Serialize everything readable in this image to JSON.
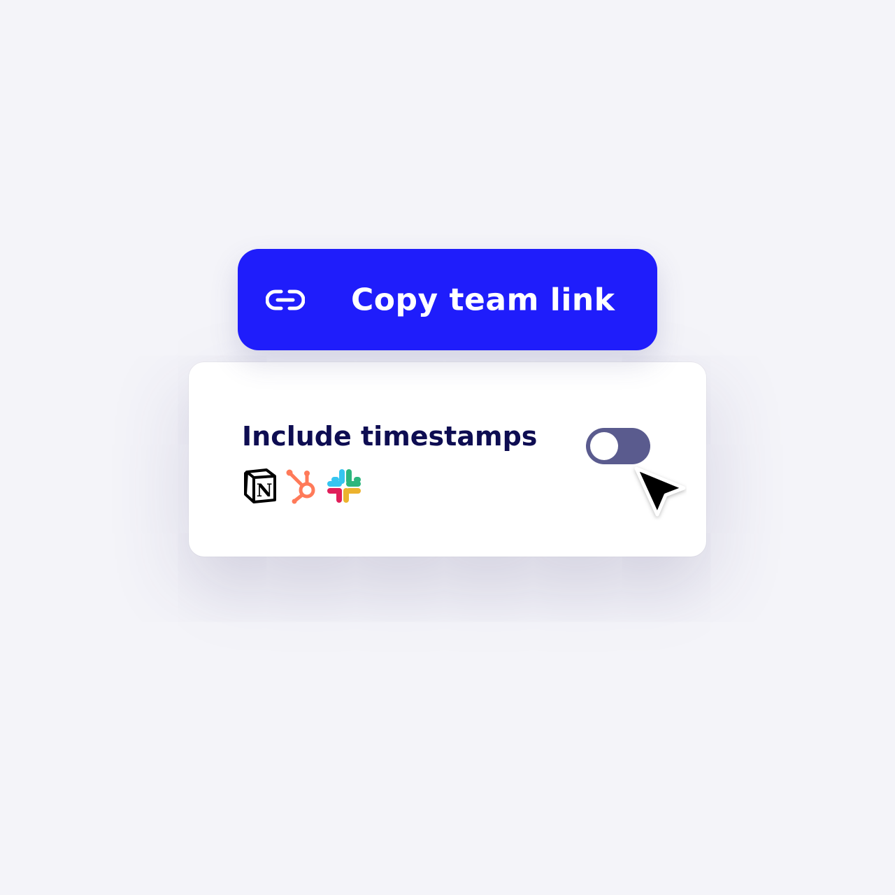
{
  "button": {
    "label": "Copy team link",
    "icon": "link-icon",
    "color": "#1f1dfb"
  },
  "setting": {
    "title": "Include timestamps",
    "integrations": [
      "notion-icon",
      "hubspot-icon",
      "slack-icon"
    ],
    "toggle_state": "off",
    "toggle_color": "#5a5b8e"
  },
  "colors": {
    "background": "#f4f4f9",
    "title_text": "#0e0d52"
  }
}
